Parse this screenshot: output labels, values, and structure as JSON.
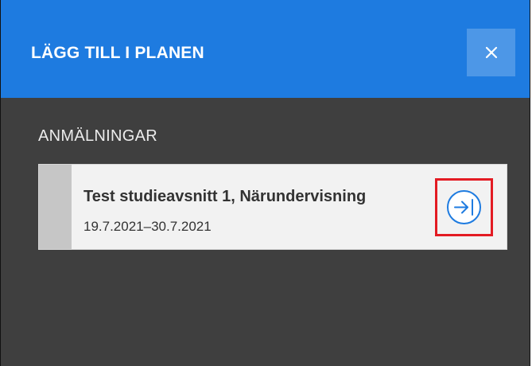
{
  "dialog": {
    "title": "LÄGG TILL I PLANEN",
    "close_icon": "close-icon",
    "colors": {
      "header": "#1e7be0",
      "body": "#3f3f3f",
      "close_button": "#4d97e7",
      "highlight": "#e31b23"
    }
  },
  "section": {
    "title": "ANMÄLNINGAR"
  },
  "enrollments": [
    {
      "title": "Test studieavsnitt 1, Närundervisning",
      "dates": "19.7.2021–30.7.2021",
      "action_icon": "arrow-right-to-bar-icon"
    }
  ]
}
